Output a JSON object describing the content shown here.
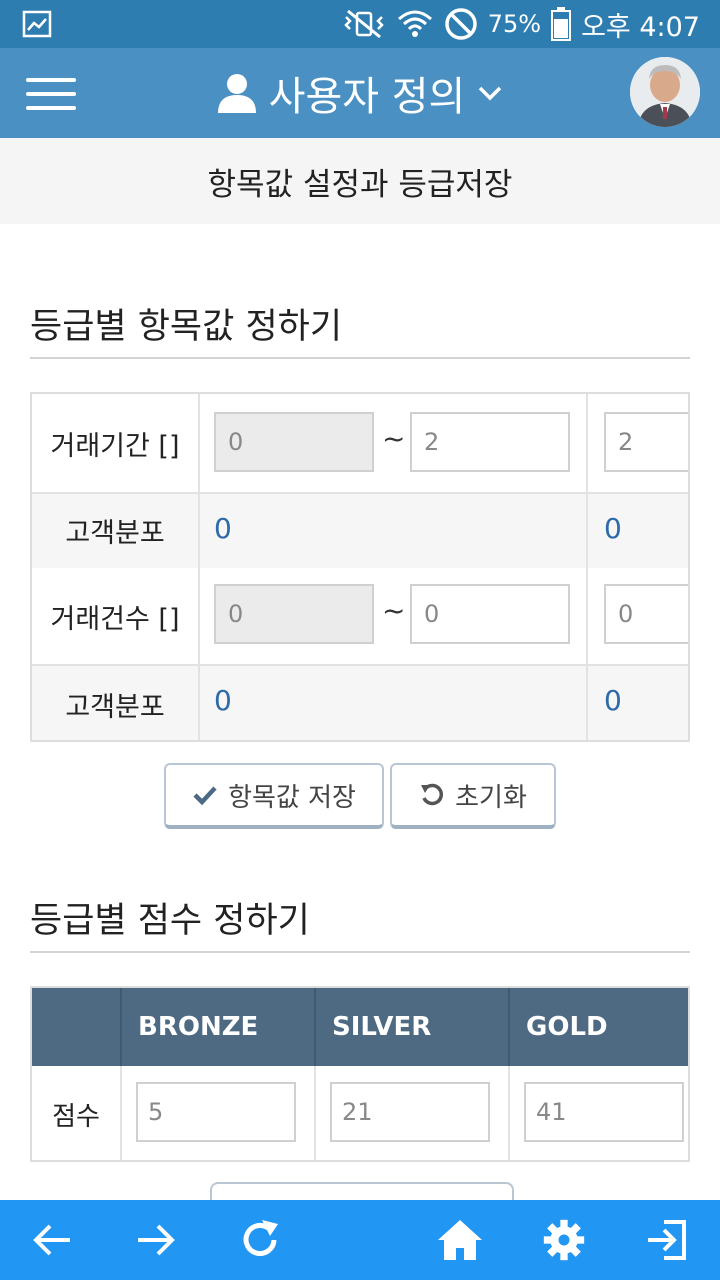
{
  "status": {
    "battery": "75%",
    "time": "오후 4:07"
  },
  "header": {
    "title": "사용자 정의"
  },
  "subheader": {
    "title": "항목값 설정과 등급저장"
  },
  "section1": {
    "title": "등급별 항목값 정하기",
    "rows": [
      {
        "label": "거래기간 []",
        "from": "0",
        "to": "2",
        "next": "2"
      },
      {
        "label": "고객분포",
        "count1": "0",
        "count2": "0"
      },
      {
        "label": "거래건수 []",
        "from": "0",
        "to": "0",
        "next": "0"
      },
      {
        "label": "고객분포",
        "count1": "0",
        "count2": "0"
      }
    ],
    "tilde": "~",
    "save_label": "항목값 저장",
    "reset_label": "초기화"
  },
  "section2": {
    "title": "등급별 점수 정하기",
    "headers": [
      "BRONZE",
      "SILVER",
      "GOLD"
    ],
    "row_label": "점수",
    "scores": [
      "5",
      "21",
      "41"
    ]
  },
  "colors": {
    "status_bar": "#2e7db0",
    "header": "#4a90c2",
    "bottom_bar": "#2196f3",
    "table_head": "#4e6a83",
    "link_number": "#2e6aa8"
  },
  "icons": {
    "menu": "menu-icon",
    "user": "user-icon",
    "dropdown": "chevron-down-icon",
    "save": "check-icon",
    "reset": "undo-icon",
    "back": "arrow-left-icon",
    "forward": "arrow-right-icon",
    "refresh": "refresh-icon",
    "home": "home-icon",
    "settings": "gear-icon",
    "logout": "exit-icon"
  }
}
